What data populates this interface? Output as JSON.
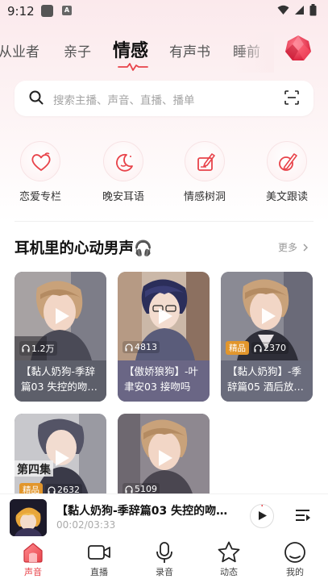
{
  "status": {
    "time": "9:12"
  },
  "tabs": [
    {
      "label": "从业者",
      "active": false
    },
    {
      "label": "亲子",
      "active": false
    },
    {
      "label": "情感",
      "active": true
    },
    {
      "label": "有声书",
      "active": false
    },
    {
      "label": "睡前",
      "active": false
    }
  ],
  "search": {
    "placeholder": "搜索主播、声音、直播、播单"
  },
  "categories": [
    {
      "label": "恋爱专栏",
      "icon": "heart-icon"
    },
    {
      "label": "晚安耳语",
      "icon": "moon-icon"
    },
    {
      "label": "情感树洞",
      "icon": "notebook-icon"
    },
    {
      "label": "美文跟读",
      "icon": "pen-icon"
    }
  ],
  "section": {
    "title": "耳机里的心动男声🎧",
    "more": "更多"
  },
  "cards": [
    {
      "badge": "",
      "plays": "1.2万",
      "title": "【黏人奶狗-季辞篇03 失控的吻…"
    },
    {
      "badge": "",
      "plays": "4813",
      "title": "【傲娇狼狗】-叶聿安03 接吻吗"
    },
    {
      "badge": "精品",
      "plays": "2370",
      "title": "【黏人奶狗】-季辞篇05 酒后放…"
    },
    {
      "badge": "精品",
      "plays": "2632",
      "title": ""
    },
    {
      "badge": "",
      "plays": "5109",
      "title": ""
    }
  ],
  "player": {
    "title": "【黏人奶狗-季辞篇03 失控的吻…",
    "time": "00:02/03:33"
  },
  "nav": [
    {
      "label": "声音",
      "active": true,
      "icon": "home-icon"
    },
    {
      "label": "直播",
      "active": false,
      "icon": "video-icon"
    },
    {
      "label": "录音",
      "active": false,
      "icon": "mic-icon"
    },
    {
      "label": "动态",
      "active": false,
      "icon": "star-icon"
    },
    {
      "label": "我的",
      "active": false,
      "icon": "profile-icon"
    }
  ],
  "colors": {
    "accent": "#e8434a",
    "badge": "#e2962c"
  }
}
